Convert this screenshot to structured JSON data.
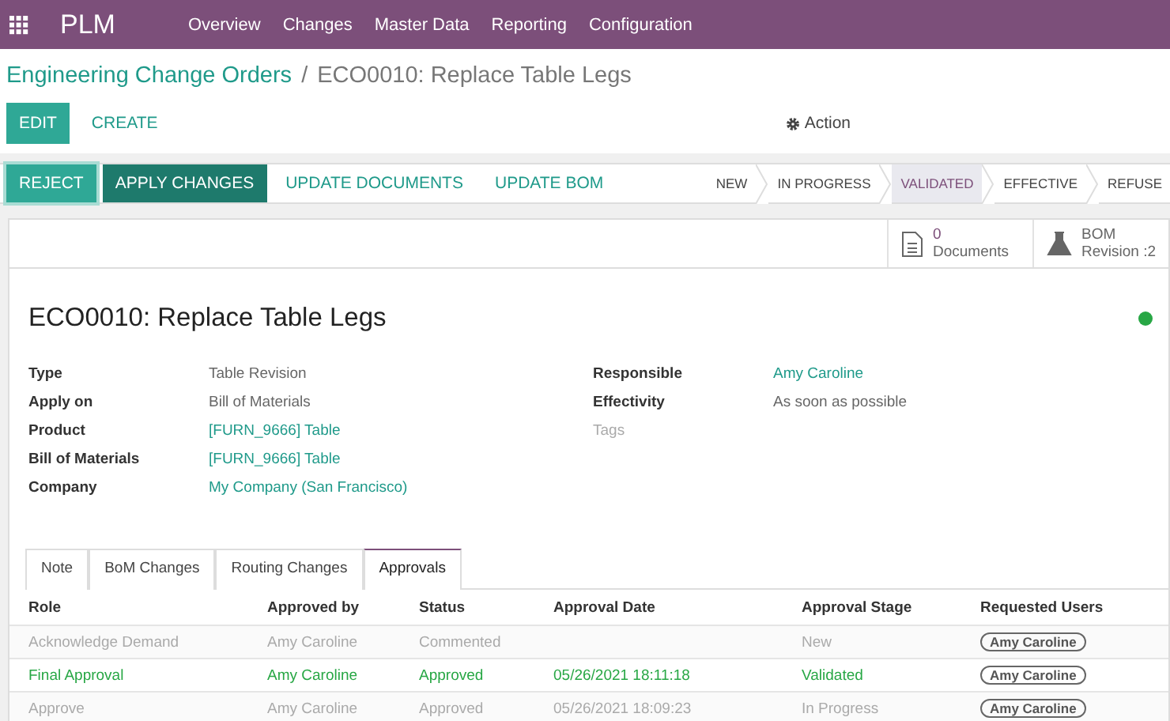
{
  "navbar": {
    "app": "PLM",
    "menu": [
      "Overview",
      "Changes",
      "Master Data",
      "Reporting",
      "Configuration"
    ]
  },
  "breadcrumb": {
    "parent": "Engineering Change Orders",
    "separator": "/",
    "current": "ECO0010: Replace Table Legs"
  },
  "control_panel": {
    "edit": "EDIT",
    "create": "CREATE",
    "action": "Action"
  },
  "header_buttons": [
    {
      "label": "REJECT",
      "kind": "primary"
    },
    {
      "label": "APPLY CHANGES",
      "kind": "dark"
    },
    {
      "label": "UPDATE DOCUMENTS",
      "kind": "link"
    },
    {
      "label": "UPDATE BOM",
      "kind": "link"
    }
  ],
  "stages": [
    {
      "label": "NEW",
      "selected": false
    },
    {
      "label": "IN PROGRESS",
      "selected": false
    },
    {
      "label": "VALIDATED",
      "selected": true
    },
    {
      "label": "EFFECTIVE",
      "selected": false
    },
    {
      "label": "REFUSE",
      "selected": false
    }
  ],
  "smart_buttons": [
    {
      "kind": "documents",
      "value": "0",
      "label": "Documents"
    },
    {
      "kind": "bom",
      "value": "BOM",
      "label": "Revision :2"
    }
  ],
  "title": "ECO0010: Replace Table Legs",
  "status_dot": {
    "color": "#28a745"
  },
  "fields_left": [
    {
      "label": "Type",
      "value": "Table Revision",
      "kind": "text",
      "muted": false
    },
    {
      "label": "Apply on",
      "value": "Bill of Materials",
      "kind": "text",
      "muted": false
    },
    {
      "label": "Product",
      "value": "[FURN_9666] Table",
      "kind": "link",
      "muted": false
    },
    {
      "label": "Bill of Materials",
      "value": "[FURN_9666] Table",
      "kind": "link",
      "muted": false
    },
    {
      "label": "Company",
      "value": "My Company (San Francisco)",
      "kind": "link",
      "muted": false
    }
  ],
  "fields_right": [
    {
      "label": "Responsible",
      "value": "Amy Caroline",
      "kind": "link",
      "muted": false
    },
    {
      "label": "Effectivity",
      "value": "As soon as possible",
      "kind": "text",
      "muted": false
    },
    {
      "label": "Tags",
      "kind": "empty",
      "muted": true
    }
  ],
  "tabs": [
    {
      "label": "Note",
      "selected": false
    },
    {
      "label": "BoM Changes",
      "selected": false
    },
    {
      "label": "Routing Changes",
      "selected": false
    },
    {
      "label": "Approvals",
      "selected": true
    }
  ],
  "table": {
    "columns": [
      "Role",
      "Approved by",
      "Status",
      "Approval Date",
      "Approval Stage",
      "Requested Users"
    ],
    "rows": [
      {
        "kind": "muted",
        "cells": [
          "Acknowledge Demand",
          "Amy Caroline",
          "Commented",
          "",
          "New"
        ],
        "users": [
          "Amy Caroline"
        ]
      },
      {
        "kind": "success",
        "cells": [
          "Final Approval",
          "Amy Caroline",
          "Approved",
          "05/26/2021 18:11:18",
          "Validated"
        ],
        "users": [
          "Amy Caroline"
        ]
      },
      {
        "kind": "muted",
        "cells": [
          "Approve",
          "Amy Caroline",
          "Approved",
          "05/26/2021 18:09:23",
          "In Progress"
        ],
        "users": [
          "Amy Caroline"
        ]
      }
    ]
  }
}
